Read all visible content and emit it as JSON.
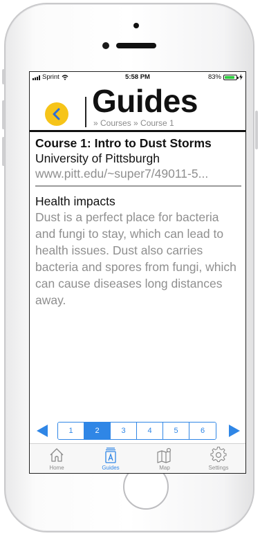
{
  "status_bar": {
    "carrier": "Sprint",
    "time": "5:58 PM",
    "battery": "83%",
    "battery_level": 0.83
  },
  "header": {
    "title": "Guides",
    "breadcrumb": "» Courses » Course 1",
    "back_icon": "chevron-left-icon",
    "accent_color": "#f6c419"
  },
  "course": {
    "title": "Course 1: Intro to Dust Storms",
    "university": "University of Pittsburgh",
    "url": "www.pitt.edu/~super7/49011-5..."
  },
  "section": {
    "heading": "Health impacts",
    "body": "Dust is a perfect place for bacteria and fungi to stay, which can lead to health issues. Dust also carries bacteria and spores from fungi, which can cause diseases long distances away."
  },
  "pager": {
    "pages": [
      "1",
      "2",
      "3",
      "4",
      "5",
      "6"
    ],
    "active": "2",
    "color": "#2f86e6"
  },
  "tabs": [
    {
      "label": "Home",
      "icon": "home-icon"
    },
    {
      "label": "Guides",
      "icon": "book-icon"
    },
    {
      "label": "Map",
      "icon": "map-icon"
    },
    {
      "label": "Settings",
      "icon": "gear-icon"
    }
  ],
  "active_tab": "Guides"
}
